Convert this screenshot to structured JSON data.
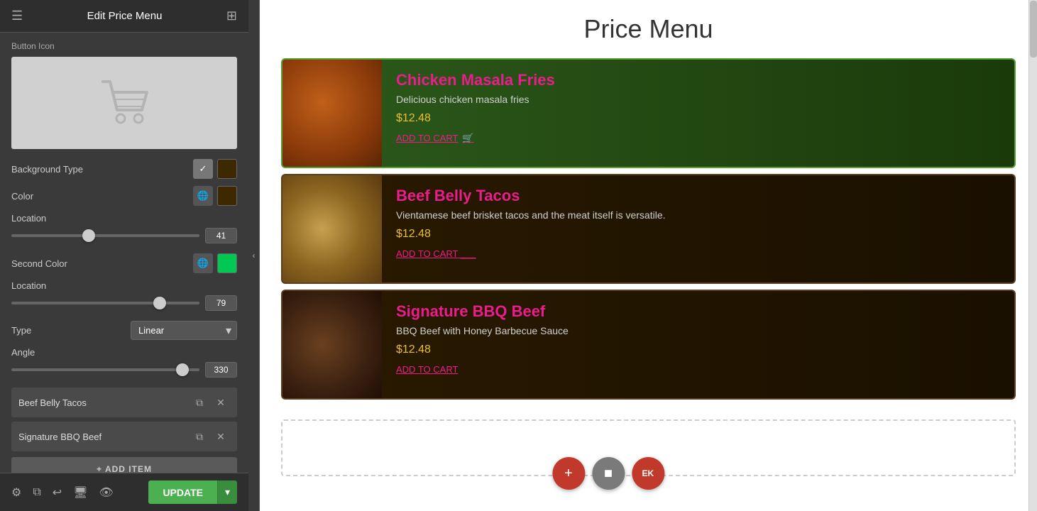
{
  "app": {
    "title": "Edit Price Menu",
    "grid_icon": "⊞",
    "menu_icon": "☰"
  },
  "left_panel": {
    "section_button_icon": "Button Icon",
    "fields": {
      "background_type_label": "Background Type",
      "color_label": "Color",
      "location_label": "Location",
      "location_value": "41",
      "second_color_label": "Second Color",
      "second_location_label": "Location",
      "second_location_value": "79",
      "type_label": "Type",
      "type_value": "Linear",
      "angle_label": "Angle",
      "angle_value": "330"
    },
    "menu_items": [
      {
        "name": "Beef Belly Tacos"
      },
      {
        "name": "Signature BBQ Beef"
      }
    ],
    "add_item_label": "+ ADD ITEM",
    "footer": {
      "update_label": "UPDATE",
      "icons": [
        "⚙",
        "⧉",
        "↩",
        "🖥",
        "👁"
      ]
    }
  },
  "right_panel": {
    "title": "Price Menu",
    "menu_items": [
      {
        "name": "Chicken Masala Fries",
        "description": "Delicious chicken masala fries",
        "price": "$12.48",
        "add_to_cart": "ADD TO CART",
        "card_style": "card-green",
        "img_style": "food-chicken"
      },
      {
        "name": "Beef Belly Tacos",
        "description": "Vientamese beef brisket tacos and the meat itself is versatile.",
        "price": "$12.48",
        "add_to_cart": "ADD TO CART",
        "card_style": "card-dark",
        "img_style": "food-tacos"
      },
      {
        "name": "Signature BBQ Beef",
        "description": "BBQ Beef with Honey Barbecue Sauce",
        "price": "$12.48",
        "add_to_cart": "ADD TO CART",
        "card_style": "card-dark",
        "img_style": "food-bbq"
      }
    ],
    "floating_buttons": {
      "add_icon": "+",
      "settings_icon": "■",
      "edit_icon": "EK"
    }
  }
}
